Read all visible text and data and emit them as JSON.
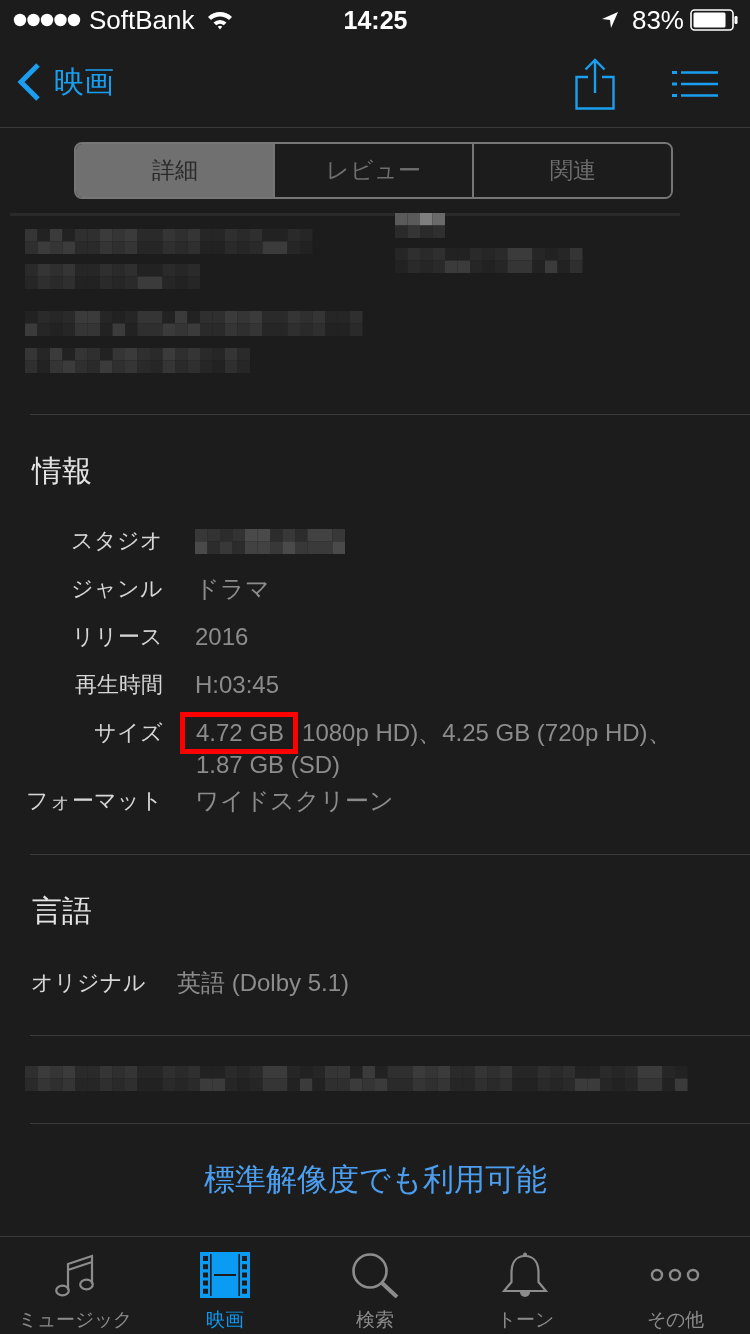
{
  "status_bar": {
    "carrier": "SoftBank",
    "time": "14:25",
    "battery": "83%"
  },
  "nav_bar": {
    "back_label": "映画"
  },
  "segments": [
    {
      "label": "詳細",
      "selected": true
    },
    {
      "label": "レビュー",
      "selected": false
    },
    {
      "label": "関連",
      "selected": false
    }
  ],
  "info": {
    "heading": "情報",
    "rows": [
      {
        "kind": "redacted",
        "label": "スタジオ"
      },
      {
        "kind": "text",
        "label": "ジャンル",
        "value": "ドラマ"
      },
      {
        "kind": "text",
        "label": "リリース",
        "value": "2016"
      },
      {
        "kind": "text",
        "label": "再生時間",
        "value": "H:03:45"
      },
      {
        "kind": "annotated",
        "label": "サイズ",
        "highlight": "4.72 GB",
        "value": "1080p HD)、4.25 GB (720p HD)、1.87 GB (SD)"
      },
      {
        "kind": "text",
        "label": "フォーマット",
        "value": "ワイドスクリーン"
      }
    ]
  },
  "languages": {
    "heading": "言語",
    "rows": [
      {
        "label": "オリジナル",
        "value": "英語 (Dolby 5.1)"
      }
    ]
  },
  "link": "標準解像度でも利用可能",
  "tab_bar": [
    {
      "label": "ミュージック",
      "selected": false
    },
    {
      "label": "映画",
      "selected": true
    },
    {
      "label": "検索",
      "selected": false
    },
    {
      "label": "トーン",
      "selected": false
    },
    {
      "label": "その他",
      "selected": false
    }
  ]
}
